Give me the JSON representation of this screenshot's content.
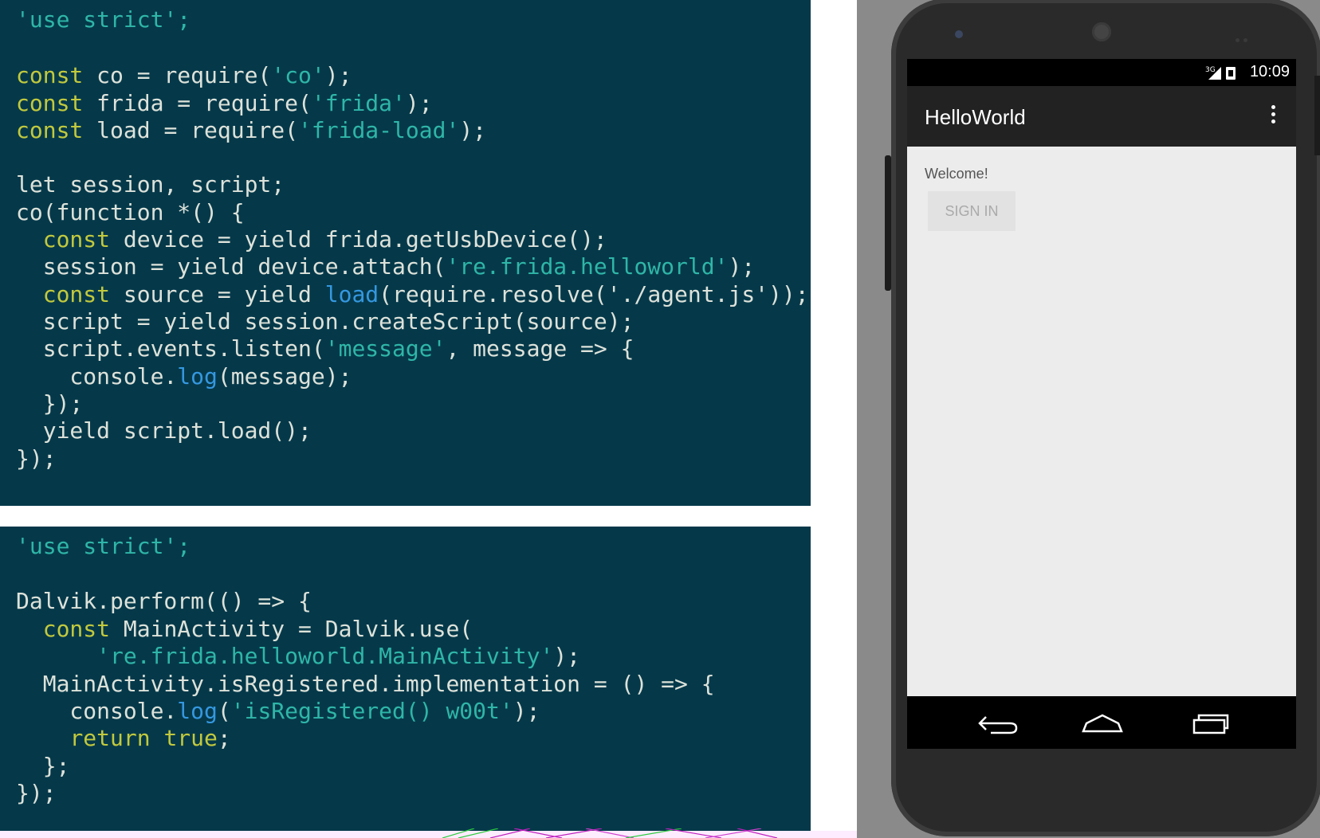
{
  "code_top": {
    "lines": [
      [
        {
          "t": "'use strict';",
          "c": "s"
        }
      ],
      [],
      [
        {
          "t": "const",
          "c": "k"
        },
        {
          "t": " co = require("
        },
        {
          "t": "'co'",
          "c": "s"
        },
        {
          "t": ");"
        }
      ],
      [
        {
          "t": "const",
          "c": "k"
        },
        {
          "t": " frida = require("
        },
        {
          "t": "'frida'",
          "c": "s"
        },
        {
          "t": ");"
        }
      ],
      [
        {
          "t": "const",
          "c": "k"
        },
        {
          "t": " load = require("
        },
        {
          "t": "'frida-load'",
          "c": "s"
        },
        {
          "t": ");"
        }
      ],
      [],
      [
        {
          "t": "let session, script;"
        }
      ],
      [
        {
          "t": "co(function *() {"
        }
      ],
      [
        {
          "t": "  "
        },
        {
          "t": "const",
          "c": "k"
        },
        {
          "t": " device = yield frida.getUsbDevice();"
        }
      ],
      [
        {
          "t": "  session = yield device.attach("
        },
        {
          "t": "'re.frida.helloworld'",
          "c": "s"
        },
        {
          "t": ");"
        }
      ],
      [
        {
          "t": "  "
        },
        {
          "t": "const",
          "c": "k"
        },
        {
          "t": " source = yield "
        },
        {
          "t": "load",
          "c": "f"
        },
        {
          "t": "(require.resolve('./agent.js'));"
        }
      ],
      [
        {
          "t": "  script = yield session.createScript(source);"
        }
      ],
      [
        {
          "t": "  script.events.listen("
        },
        {
          "t": "'message'",
          "c": "s"
        },
        {
          "t": ", message => {"
        }
      ],
      [
        {
          "t": "    console."
        },
        {
          "t": "log",
          "c": "f"
        },
        {
          "t": "(message);"
        }
      ],
      [
        {
          "t": "  });"
        }
      ],
      [
        {
          "t": "  yield script.load();"
        }
      ],
      [
        {
          "t": "});"
        }
      ]
    ]
  },
  "code_bottom": {
    "lines": [
      [
        {
          "t": "'use strict';",
          "c": "s"
        }
      ],
      [],
      [
        {
          "t": "Dalvik.perform(() => {"
        }
      ],
      [
        {
          "t": "  "
        },
        {
          "t": "const",
          "c": "k"
        },
        {
          "t": " MainActivity = Dalvik.use("
        }
      ],
      [
        {
          "t": "      "
        },
        {
          "t": "'re.frida.helloworld.MainActivity'",
          "c": "s"
        },
        {
          "t": ");"
        }
      ],
      [
        {
          "t": "  MainActivity.isRegistered.implementation = () => {"
        }
      ],
      [
        {
          "t": "    console."
        },
        {
          "t": "log",
          "c": "f"
        },
        {
          "t": "("
        },
        {
          "t": "'isRegistered() w00t'",
          "c": "s"
        },
        {
          "t": ");"
        }
      ],
      [
        {
          "t": "    "
        },
        {
          "t": "return true",
          "c": "k"
        },
        {
          "t": ";"
        }
      ],
      [
        {
          "t": "  };"
        }
      ],
      [
        {
          "t": "});"
        }
      ]
    ]
  },
  "phone": {
    "status_network": "3G",
    "status_time": "10:09",
    "app_title": "HelloWorld",
    "welcome_text": "Welcome!",
    "sign_in_label": "SIGN IN"
  },
  "colors": {
    "code_bg": "#05394a",
    "keyword": "#c2c93d",
    "string": "#2fb6a8",
    "function": "#3598e0",
    "plain": "#dde2da"
  }
}
